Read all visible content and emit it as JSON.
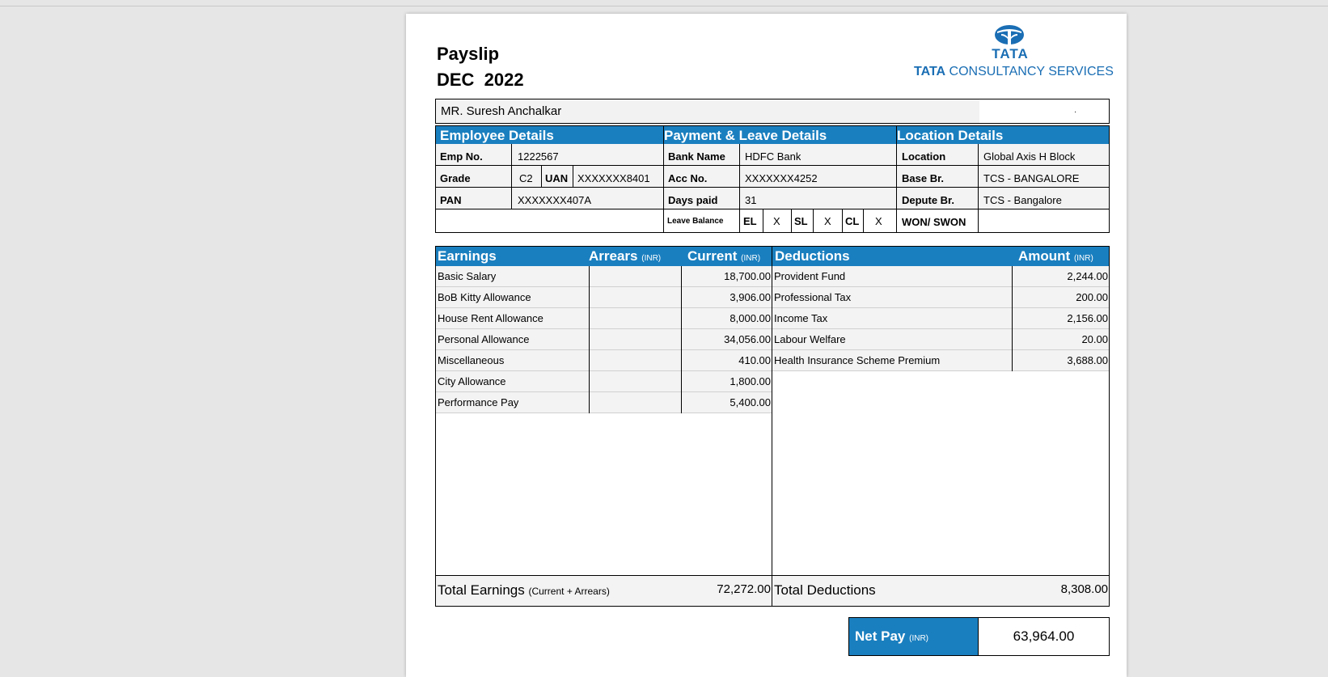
{
  "header": {
    "title": "Payslip",
    "period": "DEC  2022",
    "logo_mark": "TATA",
    "company": "CONSULTANCY SERVICES",
    "company_prefix": "TATA",
    "logo_icon": "tata-logo-icon",
    "brand_color": "#1a7fbf"
  },
  "employee_name": "MR. Suresh Anchalkar",
  "sections": {
    "employee": "Employee Details",
    "payment": "Payment & Leave Details",
    "location": "Location Details"
  },
  "employee": {
    "emp_no_label": "Emp No.",
    "emp_no": "1222567",
    "grade_label": "Grade",
    "grade": "C2",
    "uan_label": "UAN",
    "uan": "XXXXXXX8401",
    "pan_label": "PAN",
    "pan": "XXXXXXX407A"
  },
  "payment": {
    "bank_label": "Bank Name",
    "bank": "HDFC Bank",
    "acc_label": "Acc No.",
    "acc": "XXXXXXX4252",
    "days_label": "Days paid",
    "days": "31",
    "leave_label": "Leave Balance",
    "el_label": "EL",
    "el": "X",
    "sl_label": "SL",
    "sl": "X",
    "cl_label": "CL",
    "cl": "X"
  },
  "location": {
    "location_label": "Location",
    "location": "Global Axis H Block",
    "base_label": "Base Br.",
    "base": "TCS - BANGALORE",
    "depute_label": "Depute Br.",
    "depute": "TCS - Bangalore",
    "won_label": "WON/ SWON",
    "won": ""
  },
  "earnings_table": {
    "earnings_head": "Earnings",
    "arrears_head": "Arrears",
    "current_head": "Current",
    "inr": "(INR)",
    "deductions_head": "Deductions",
    "amount_head": "Amount",
    "earnings": [
      {
        "name": "Basic Salary",
        "arrears": "",
        "current": "18,700.00"
      },
      {
        "name": "BoB Kitty Allowance",
        "arrears": "",
        "current": "3,906.00"
      },
      {
        "name": "House Rent Allowance",
        "arrears": "",
        "current": "8,000.00"
      },
      {
        "name": "Personal Allowance",
        "arrears": "",
        "current": "34,056.00"
      },
      {
        "name": "Miscellaneous",
        "arrears": "",
        "current": "410.00"
      },
      {
        "name": "City Allowance",
        "arrears": "",
        "current": "1,800.00"
      },
      {
        "name": "Performance Pay",
        "arrears": "",
        "current": "5,400.00"
      }
    ],
    "deductions": [
      {
        "name": "Provident Fund",
        "amount": "2,244.00"
      },
      {
        "name": "Professional Tax",
        "amount": "200.00"
      },
      {
        "name": "Income Tax",
        "amount": "2,156.00"
      },
      {
        "name": "Labour Welfare",
        "amount": "20.00"
      },
      {
        "name": "Health Insurance Scheme Premium",
        "amount": "3,688.00"
      }
    ],
    "total_earnings_label": "Total Earnings",
    "total_earnings_note": "(Current + Arrears)",
    "total_earnings": "72,272.00",
    "total_deductions_label": "Total Deductions",
    "total_deductions": "8,308.00"
  },
  "net_pay": {
    "label": "Net Pay",
    "unit": "(INR)",
    "value": "63,964.00"
  }
}
